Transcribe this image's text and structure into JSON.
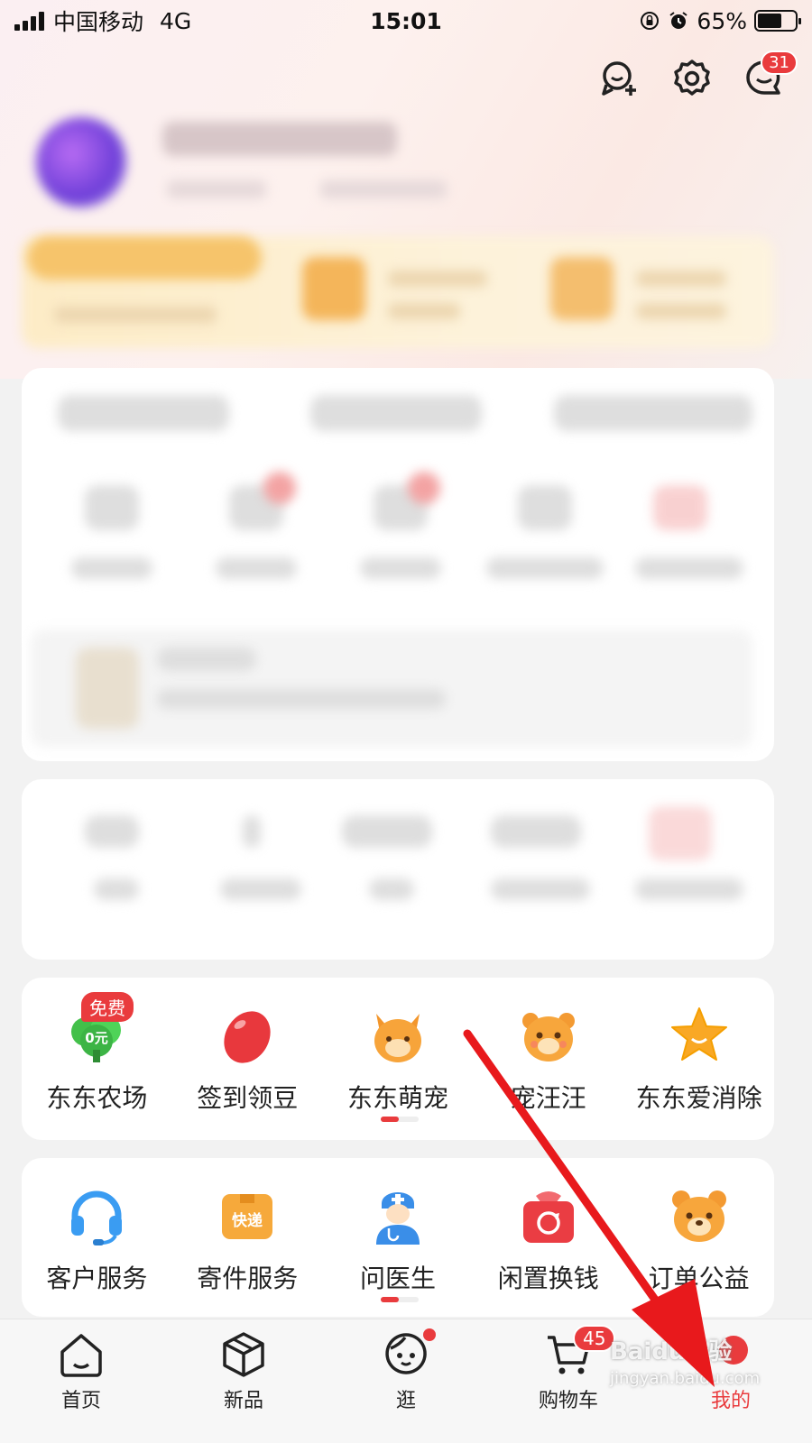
{
  "status_bar": {
    "carrier": "中国移动",
    "network": "4G",
    "time": "15:01",
    "battery": "65%",
    "battery_level": 0.65
  },
  "header": {
    "icons": [
      "add-friend-icon",
      "gear-icon",
      "message-icon"
    ],
    "message_badge": "31"
  },
  "games": {
    "items": [
      {
        "label": "东东农场",
        "icon": "farm-tree-icon",
        "badge": "免费",
        "icon_text": "0元"
      },
      {
        "label": "签到领豆",
        "icon": "red-bean-icon"
      },
      {
        "label": "东东萌宠",
        "icon": "cute-pet-icon"
      },
      {
        "label": "宠汪汪",
        "icon": "dog-icon"
      },
      {
        "label": "东东爱消除",
        "icon": "star-icon"
      }
    ]
  },
  "services": {
    "items": [
      {
        "label": "客户服务",
        "icon": "headset-icon"
      },
      {
        "label": "寄件服务",
        "icon": "express-box-icon",
        "icon_text": "快递"
      },
      {
        "label": "问医生",
        "icon": "doctor-icon"
      },
      {
        "label": "闲置换钱",
        "icon": "recycle-bag-icon"
      },
      {
        "label": "订单公益",
        "icon": "bear-icon"
      }
    ]
  },
  "bottom_nav": {
    "items": [
      {
        "label": "首页",
        "icon": "home-icon"
      },
      {
        "label": "新品",
        "icon": "box-icon"
      },
      {
        "label": "逛",
        "icon": "discover-face-icon"
      },
      {
        "label": "购物车",
        "icon": "cart-icon",
        "badge": "45"
      },
      {
        "label": "我的",
        "icon": "profile-icon",
        "active": true
      }
    ]
  },
  "watermark": {
    "line1": "Baidu经验",
    "line2": "jingyan.baidu.com"
  },
  "colors": {
    "accent": "#e93b3d",
    "background": "#f2f2f2"
  }
}
